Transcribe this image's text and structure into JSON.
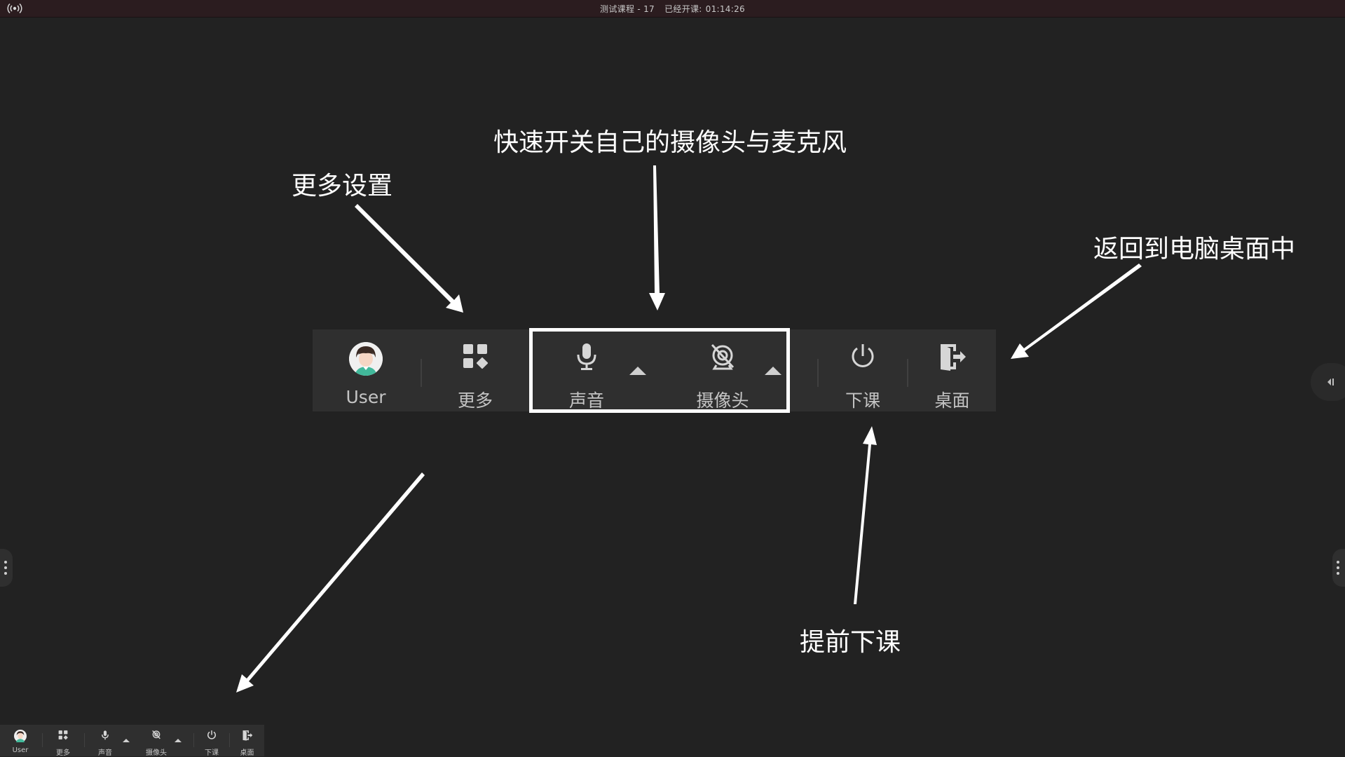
{
  "titlebar": {
    "course": "测试课程 - 17",
    "elapsed_label": "已经开课:",
    "elapsed_time": "01:14:26"
  },
  "annotations": {
    "more_settings": "更多设置",
    "toggle_av": "快速开关自己的摄像头与麦克风",
    "back_desktop": "返回到电脑桌面中",
    "end_early": "提前下课"
  },
  "toolbar": {
    "user": "User",
    "more": "更多",
    "sound": "声音",
    "camera": "摄像头",
    "end_class": "下课",
    "desktop": "桌面"
  },
  "mini_toolbar": {
    "user": "User",
    "more": "更多",
    "sound": "声音",
    "camera": "摄像头",
    "end_class": "下课",
    "desktop": "桌面"
  },
  "icons": {
    "signal": "broadcast-icon",
    "more": "grid-icon",
    "sound": "microphone-icon",
    "camera": "camera-off-icon",
    "end_class": "power-icon",
    "desktop": "exit-door-icon"
  },
  "colors": {
    "background": "#222222",
    "toolbar": "#2f2f2f",
    "highlight": "#ffffff"
  }
}
